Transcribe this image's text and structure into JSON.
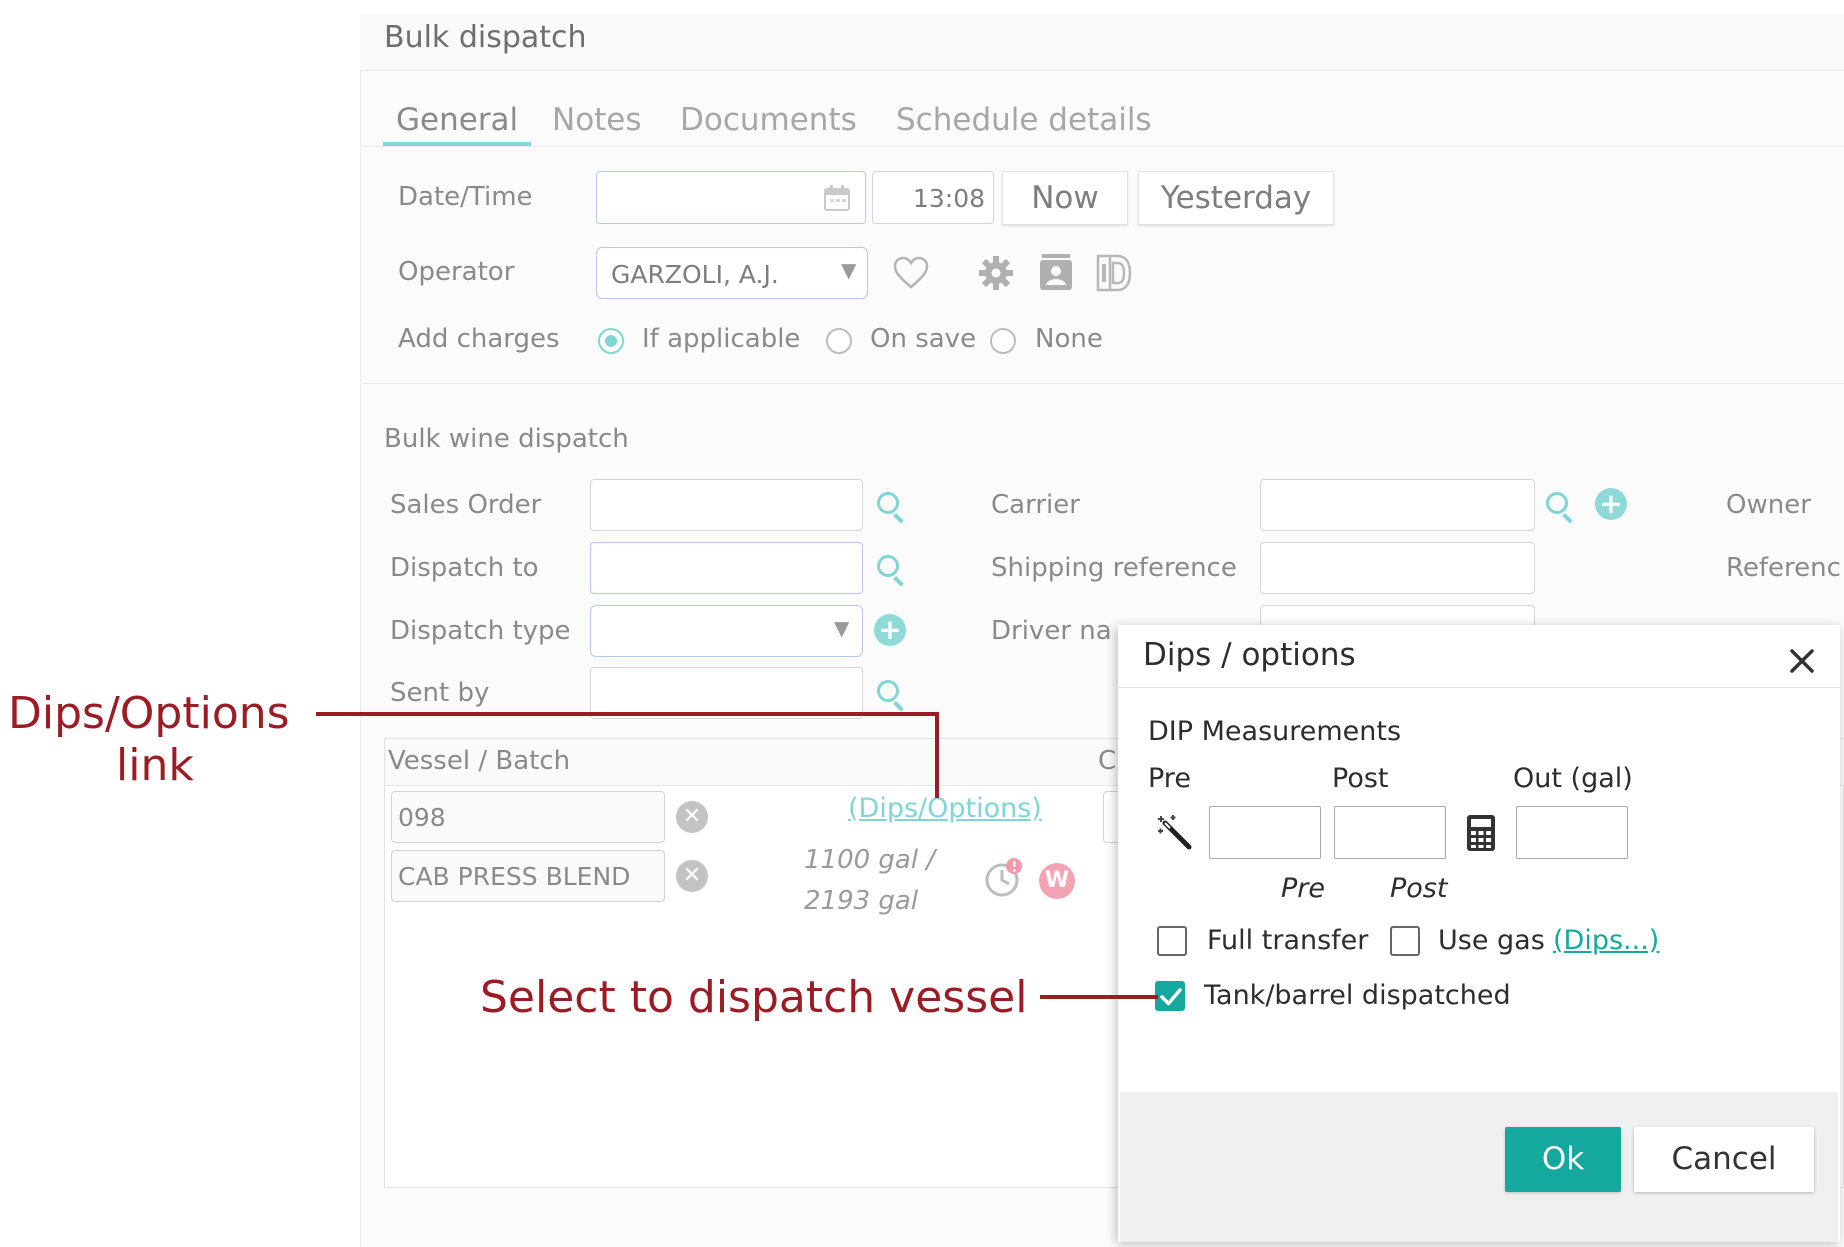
{
  "window": {
    "title": "Bulk dispatch"
  },
  "tabs": [
    {
      "label": "General"
    },
    {
      "label": "Notes"
    },
    {
      "label": "Documents"
    },
    {
      "label": "Schedule details"
    }
  ],
  "general": {
    "datetime_label": "Date/Time",
    "date_value": "",
    "time_value": "13:08",
    "now_button": "Now",
    "yesterday_button": "Yesterday",
    "operator_label": "Operator",
    "operator_value": "GARZOLI, A.J.",
    "add_charges_label": "Add charges",
    "charges_options": [
      "If applicable",
      "On save",
      "None"
    ],
    "charges_selected": "If applicable"
  },
  "bulk": {
    "section_title": "Bulk wine dispatch",
    "sales_order_label": "Sales Order",
    "dispatch_to_label": "Dispatch to",
    "dispatch_type_label": "Dispatch type",
    "sent_by_label": "Sent by",
    "carrier_label": "Carrier",
    "shipping_ref_label": "Shipping reference",
    "driver_label": "Driver na",
    "owner_label": "Owner",
    "reference_label": "Referenc"
  },
  "vessel": {
    "header": "Vessel / Batch",
    "col2_partial": "C",
    "vessel_value": "098",
    "batch_value": "CAB PRESS BLEND",
    "dips_link": "(Dips/Options)",
    "volume_line1": "1100 gal /",
    "volume_line2": "2193 gal",
    "w_badge": "W"
  },
  "dialog": {
    "title": "Dips / options",
    "dip_heading": "DIP Measurements",
    "col_pre": "Pre",
    "col_post": "Post",
    "col_out": "Out (gal)",
    "sub_pre": "Pre",
    "sub_post": "Post",
    "full_transfer_label": "Full transfer",
    "use_gas_label": "Use gas",
    "dips_link": "(Dips...)",
    "tank_dispatched_label": "Tank/barrel dispatched",
    "full_transfer_checked": false,
    "use_gas_checked": false,
    "tank_dispatched_checked": true,
    "ok_button": "Ok",
    "cancel_button": "Cancel"
  },
  "annotations": {
    "dips_line1": "Dips/Options",
    "dips_line2": "link",
    "select_text": "Select to dispatch vessel"
  },
  "colors": {
    "accent": "#7fd6d3",
    "primary_button": "#14a89f",
    "annotation": "#9b1c24",
    "link": "#14a89f"
  }
}
